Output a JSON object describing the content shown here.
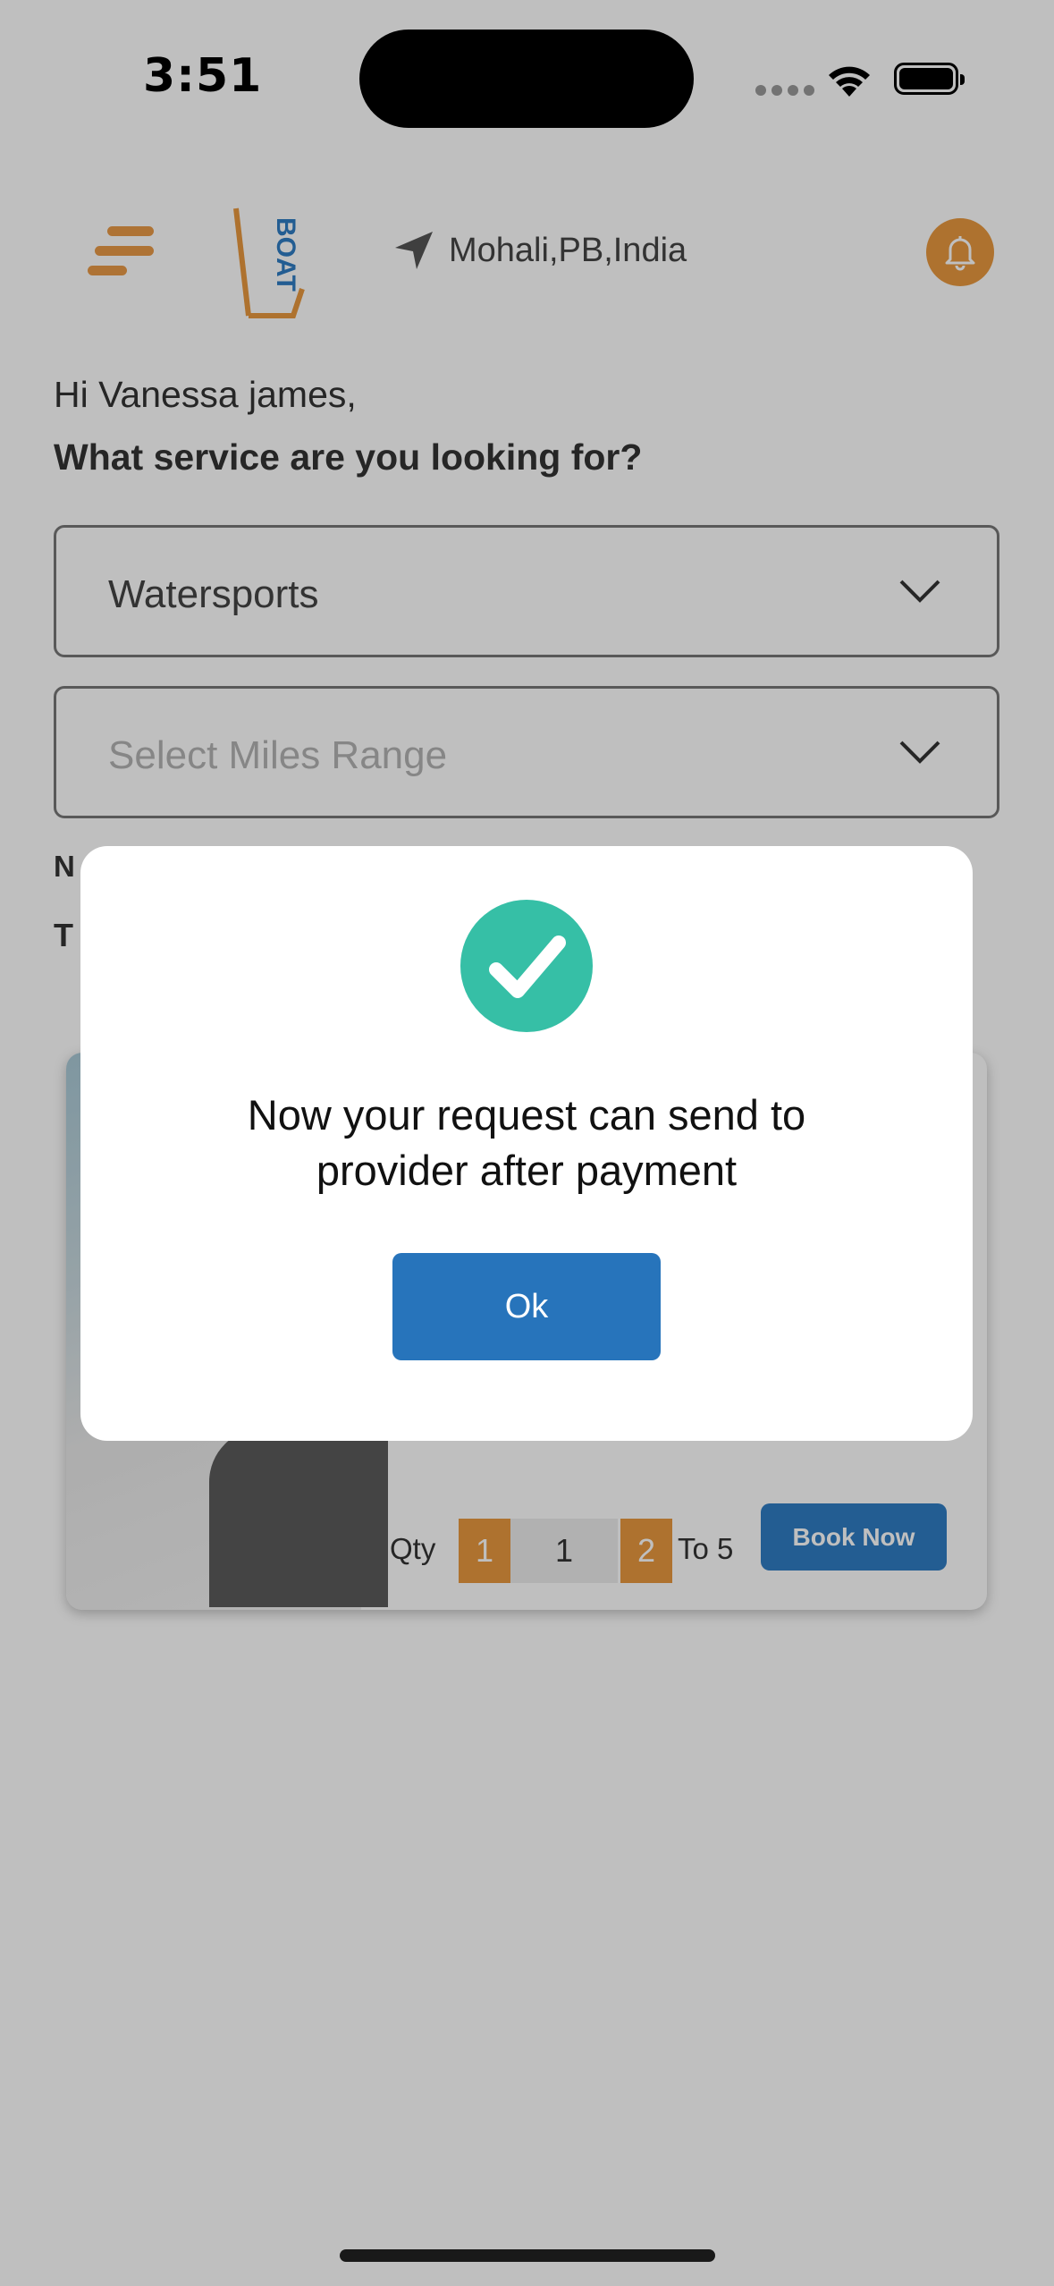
{
  "status_bar": {
    "time": "3:51"
  },
  "header": {
    "location": "Mohali,PB,India"
  },
  "greeting": {
    "hello": "Hi Vanessa james,",
    "question": "What service are you looking for?"
  },
  "filters": {
    "service_value": "Watersports",
    "miles_placeholder": "Select Miles Range"
  },
  "partial_labels": {
    "first": "N",
    "second": "T"
  },
  "card": {
    "qty_label": "Qty",
    "qty_minus": "1",
    "qty_value": "1",
    "qty_plus": "2",
    "qty_range": "To 5",
    "book_button": "Book Now"
  },
  "modal": {
    "message_line1": "Now your request can send to",
    "message_line2": "provider after payment",
    "ok_button": "Ok"
  },
  "colors": {
    "accent_orange": "#e8993f",
    "primary_blue": "#2774bb",
    "success_green": "#36bfa6"
  }
}
